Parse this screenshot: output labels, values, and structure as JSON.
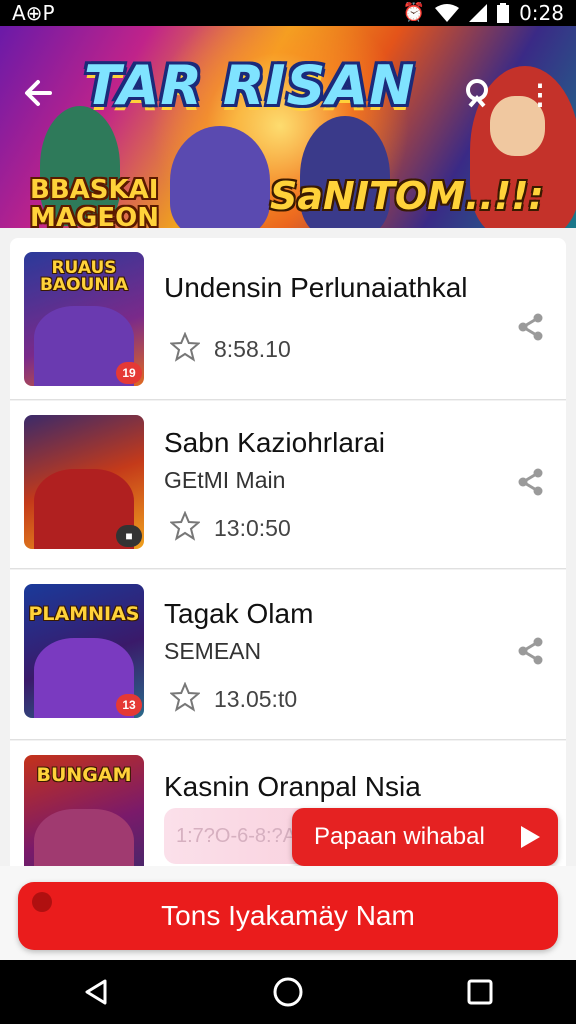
{
  "status_bar": {
    "left": "A⊕P",
    "time": "0:28"
  },
  "hero": {
    "title": "TAR RISAN",
    "left_text_line1": "BBASKAI",
    "left_text_line2": "MAGEON",
    "right_text": "SaNITOM..!!:"
  },
  "items": [
    {
      "title": "Undensin Perlunaiathkal",
      "subtitle": "",
      "time": "8:58.10",
      "thumb_title": "RUAUS BAOUNIA",
      "badge": "19"
    },
    {
      "title": "Sabn Kaziohrlarai",
      "subtitle": "GEtMI Main",
      "time": "13:0:50",
      "thumb_title": "",
      "badge": ""
    },
    {
      "title": "Tagak Olam",
      "subtitle": "SEMEAN",
      "time": "13.05:t0",
      "thumb_title": "PLAMNIAS",
      "badge": "13"
    },
    {
      "title": "Kasnin Oranpal Nsia",
      "subtitle": "",
      "time": "",
      "thumb_title": "BUNGAM",
      "badge": ""
    }
  ],
  "promo_text": "1:7?O-6-8:?A0:0",
  "play_button_label": "Papaan wihabal",
  "cta_label": "Tons Iyakamäy Nam",
  "colors": {
    "accent": "#ea1c1c",
    "hero_title": "#7fe3ff",
    "hero_yellow": "#ffd23a"
  }
}
